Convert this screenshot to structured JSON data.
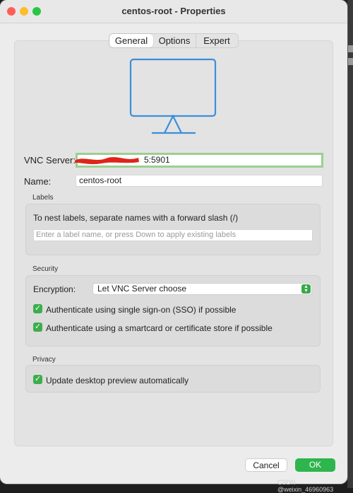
{
  "window": {
    "title": "centos-root - Properties"
  },
  "tabs": [
    {
      "label": "General",
      "active": true
    },
    {
      "label": "Options",
      "active": false
    },
    {
      "label": "Expert",
      "active": false
    }
  ],
  "general": {
    "vnc_server_label": "VNC Server:",
    "vnc_server_value": "5:5901",
    "name_label": "Name:",
    "name_value": "centos-root"
  },
  "labels_section": {
    "title": "Labels",
    "hint": "To nest labels, separate names with a forward slash (/)",
    "input_placeholder": "Enter a label name, or press Down to apply existing labels"
  },
  "security": {
    "title": "Security",
    "encryption_label": "Encryption:",
    "encryption_value": "Let VNC Server choose",
    "sso_label": "Authenticate using single sign-on (SSO) if possible",
    "sso_checked": true,
    "smartcard_label": "Authenticate using a smartcard or certificate store if possible",
    "smartcard_checked": true
  },
  "privacy": {
    "title": "Privacy",
    "preview_label": "Update desktop preview automatically",
    "preview_checked": true
  },
  "buttons": {
    "cancel": "Cancel",
    "ok": "OK"
  },
  "watermark": "CSDN @weixin_46960963",
  "icons": [
    "monitor-icon",
    "chevron-updown-icon",
    "checkmark-icon"
  ],
  "colors": {
    "accent_green": "#2eb54d",
    "focus_ring": "#9bcf8f",
    "monitor_blue": "#3b8fd9"
  }
}
